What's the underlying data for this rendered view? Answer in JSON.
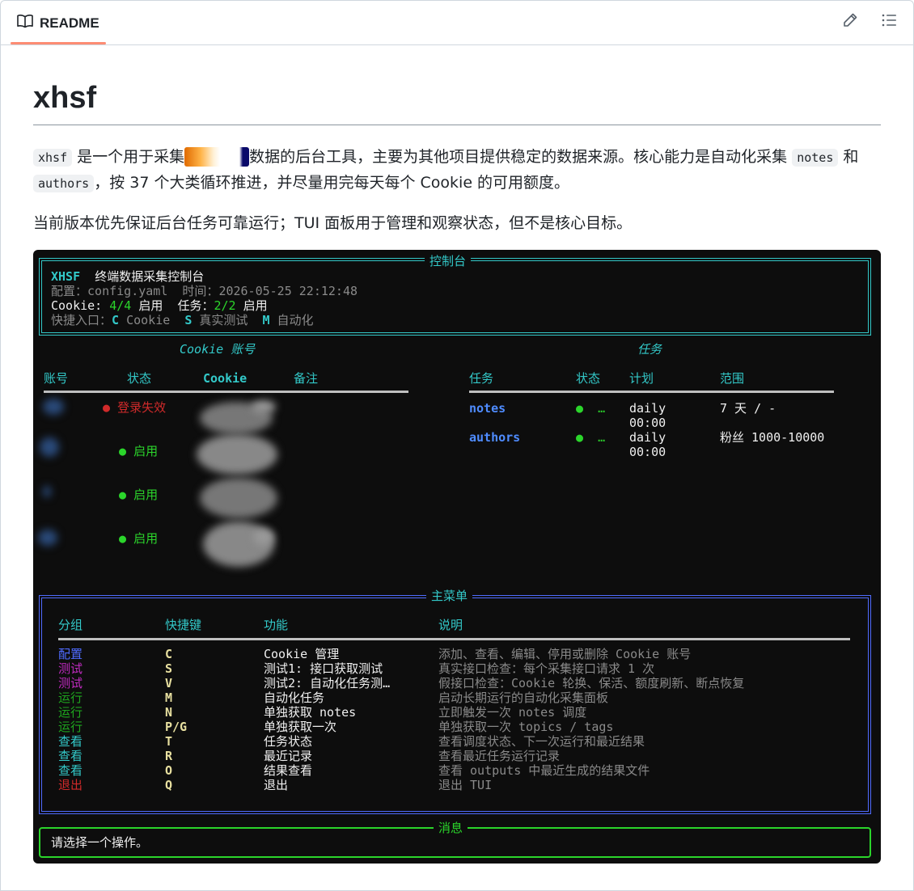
{
  "header": {
    "tab_label": "README"
  },
  "doc": {
    "title": "xhsf",
    "p1": {
      "code1": "xhsf",
      "t1": " 是一个用于采集",
      "t2": "数据的后台工具，主要为其他项目提供稳定的数据来源。核心能力是自动化采集 ",
      "code2": "notes",
      "t3": " 和 ",
      "code3": "authors",
      "t4": "，按 37 个大类循环推进，并尽量用完每天每个 Cookie 的可用额度。"
    },
    "p2": "当前版本优先保证后台任务可靠运行；TUI 面板用于管理和观察状态，但不是核心目标。"
  },
  "terminal": {
    "console": {
      "box_title": "控制台",
      "app_name": "XHSF",
      "app_title": "终端数据采集控制台",
      "config_label": "配置：",
      "config_value": "config.yaml",
      "time_label": "时间：",
      "time_value": "2026-05-25 22:12:48",
      "cookie_label": "Cookie:",
      "cookie_value": "4/4",
      "cookie_suffix": "启用",
      "task_label": "任务：",
      "task_value": "2/2",
      "task_suffix": "启用",
      "shortcut_label": "快捷入口：",
      "sc1_key": "C",
      "sc1_label": "Cookie",
      "sc2_key": "S",
      "sc2_label": "真实测试",
      "sc3_key": "M",
      "sc3_label": "自动化"
    },
    "cookie_panel": {
      "title": "Cookie 账号",
      "headers": [
        "账号",
        "状态",
        "Cookie",
        "备注"
      ],
      "rows": [
        {
          "status": "登录失效",
          "status_color": "#d02a2a",
          "dot": "●"
        },
        {
          "status": "启用",
          "status_color": "#2bd52b",
          "dot": "●"
        },
        {
          "status": "启用",
          "status_color": "#2bd52b",
          "dot": "●"
        },
        {
          "status": "启用",
          "status_color": "#2bd52b",
          "dot": "●"
        }
      ]
    },
    "task_panel": {
      "title": "任务",
      "headers": [
        "任务",
        "状态",
        "计划",
        "范围"
      ],
      "rows": [
        {
          "name": "notes",
          "dot": "●",
          "ellipsis": "…",
          "plan1": "daily",
          "plan2": "00:00",
          "range": "7 天 / -"
        },
        {
          "name": "authors",
          "dot": "●",
          "ellipsis": "…",
          "plan1": "daily",
          "plan2": "00:00",
          "range": "粉丝 1000-10000"
        }
      ]
    },
    "menu": {
      "box_title": "主菜单",
      "headers": [
        "分组",
        "快捷键",
        "功能",
        "说明"
      ],
      "rows": [
        {
          "group": "配置",
          "group_color": "#4f6bff",
          "key": "C",
          "func": "Cookie 管理",
          "desc": "添加、查看、编辑、停用或删除 Cookie 账号"
        },
        {
          "group": "测试",
          "group_color": "#c02bc0",
          "key": "S",
          "func": "测试1: 接口获取测试",
          "desc": "真实接口检查：每个采集接口请求 1 次"
        },
        {
          "group": "测试",
          "group_color": "#c02bc0",
          "key": "V",
          "func": "测试2: 自动化任务测…",
          "desc": "假接口检查：Cookie 轮换、保活、额度刷新、断点恢复"
        },
        {
          "group": "运行",
          "group_color": "#1ea51e",
          "key": "M",
          "func": "自动化任务",
          "desc": "启动长期运行的自动化采集面板"
        },
        {
          "group": "运行",
          "group_color": "#1ea51e",
          "key": "N",
          "func": "单独获取 notes",
          "desc": "立即触发一次 notes 调度"
        },
        {
          "group": "运行",
          "group_color": "#1ea51e",
          "key": "P/G",
          "func": "单独获取一次",
          "desc": "单独获取一次 topics / tags"
        },
        {
          "group": "查看",
          "group_color": "#33c9c9",
          "key": "T",
          "func": "任务状态",
          "desc": "查看调度状态、下一次运行和最近结果"
        },
        {
          "group": "查看",
          "group_color": "#33c9c9",
          "key": "R",
          "func": "最近记录",
          "desc": "查看最近任务运行记录"
        },
        {
          "group": "查看",
          "group_color": "#33c9c9",
          "key": "O",
          "func": "结果查看",
          "desc": "查看 outputs 中最近生成的结果文件"
        },
        {
          "group": "退出",
          "group_color": "#d02a2a",
          "key": "Q",
          "func": "退出",
          "desc": "退出 TUI"
        }
      ]
    },
    "message": {
      "box_title": "消息",
      "text": "请选择一个操作。"
    }
  },
  "colors": {
    "accent_underline": "#fd8c73",
    "terminal_bg": "#0d0d0d",
    "cyan": "#33c9c9",
    "green": "#2bd52b",
    "blue": "#4f6bff"
  },
  "icons": {
    "tab": "book-icon",
    "edit": "pencil-icon",
    "outline": "list-icon"
  }
}
